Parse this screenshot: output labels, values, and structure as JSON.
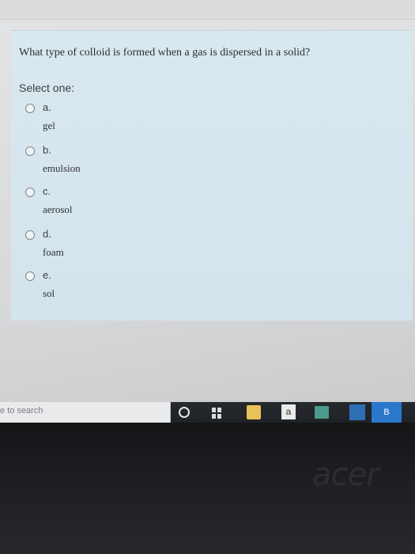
{
  "quiz": {
    "question": "What type of colloid is formed when a gas is dispersed in a solid?",
    "select_label": "Select one:",
    "options": [
      {
        "letter": "a.",
        "text": "gel"
      },
      {
        "letter": "b.",
        "text": "emulsion"
      },
      {
        "letter": "c.",
        "text": "aerosol"
      },
      {
        "letter": "d.",
        "text": "foam"
      },
      {
        "letter": "e.",
        "text": "sol"
      }
    ]
  },
  "taskbar": {
    "search_text": "e to search",
    "icons": [
      "cortana-icon",
      "task-view-icon",
      "store-icon",
      "amazon-icon",
      "photos-icon",
      "app-icon",
      "browser-icon"
    ],
    "amazon_letter": "a",
    "browser_letter": "B"
  },
  "bezel": {
    "logo": "acer"
  }
}
